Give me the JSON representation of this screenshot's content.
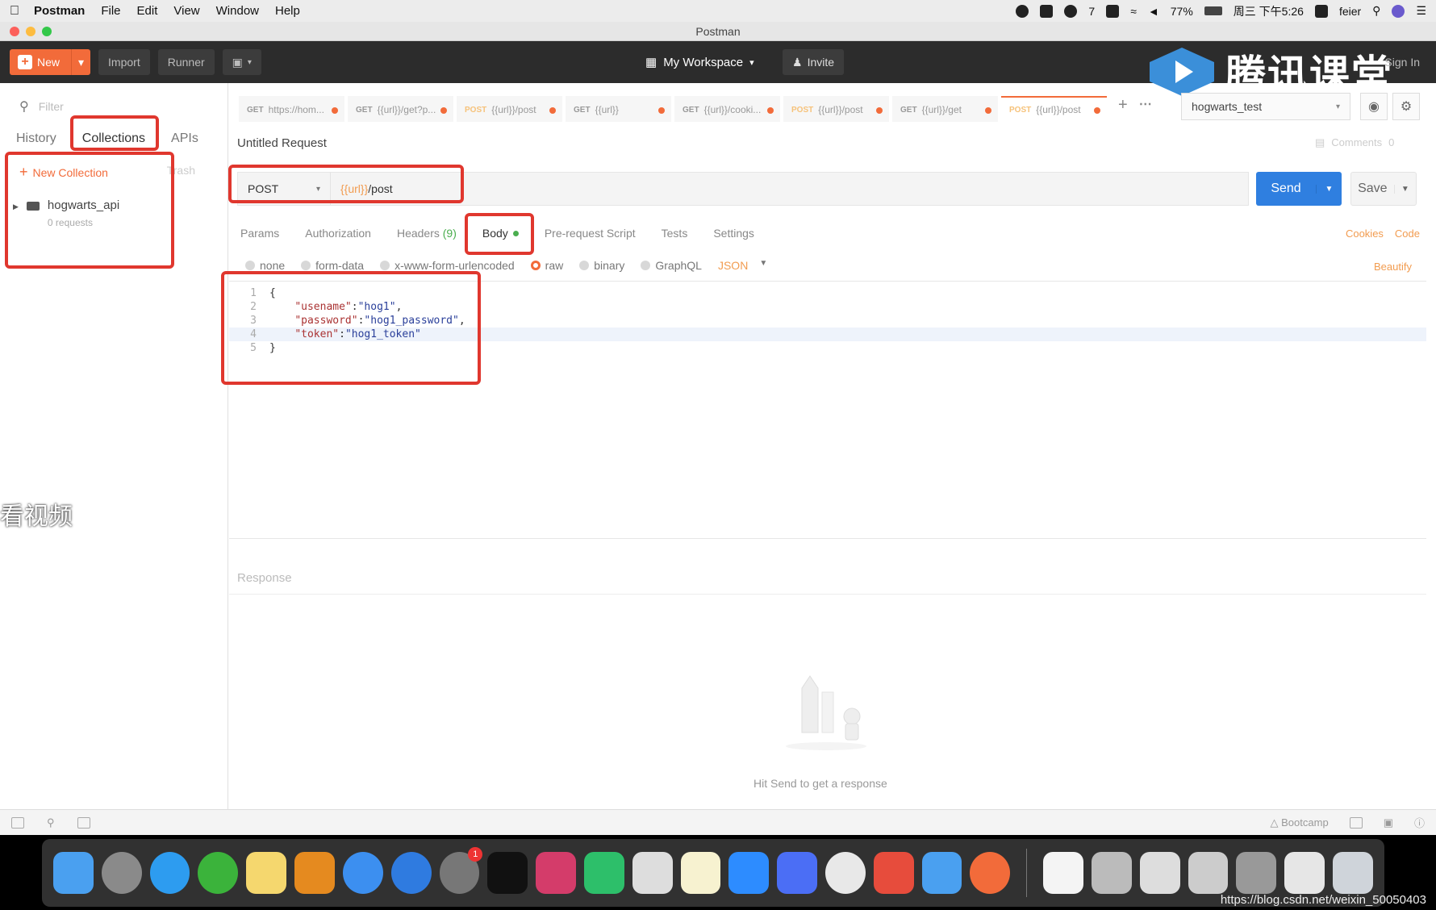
{
  "menubar": {
    "app_name": "Postman",
    "menus": [
      "File",
      "Edit",
      "View",
      "Window",
      "Help"
    ],
    "wechat_count": "7",
    "battery": "77%",
    "clock": "周三 下午5:26",
    "user": "feier"
  },
  "window": {
    "title": "Postman"
  },
  "toolbar": {
    "new_label": "New",
    "import_label": "Import",
    "runner_label": "Runner",
    "workspace_label": "My Workspace",
    "invite_label": "Invite",
    "signin_label": "Sign In",
    "watermark_text": "腾讯课堂"
  },
  "sidebar": {
    "filter_placeholder": "Filter",
    "tabs": [
      "History",
      "Collections",
      "APIs"
    ],
    "new_collection_label": "New Collection",
    "trash_label": "Trash",
    "collections": [
      {
        "name": "hogwarts_api",
        "meta": "0 requests"
      }
    ]
  },
  "request_tabs": [
    {
      "method": "GET",
      "url": "https://hom..."
    },
    {
      "method": "GET",
      "url": "{{url}}/get?p..."
    },
    {
      "method": "POST",
      "url": "{{url}}/post"
    },
    {
      "method": "GET",
      "url": "{{url}}"
    },
    {
      "method": "GET",
      "url": "{{url}}/cooki..."
    },
    {
      "method": "POST",
      "url": "{{url}}/post"
    },
    {
      "method": "GET",
      "url": "{{url}}/get"
    },
    {
      "method": "POST",
      "url": "{{url}}/post"
    }
  ],
  "environment": {
    "selected": "hogwarts_test"
  },
  "request": {
    "title": "Untitled Request",
    "comments_label": "Comments",
    "comments_count": "0",
    "method": "POST",
    "url_var": "{{url}}",
    "url_path": "/post",
    "send_label": "Send",
    "save_label": "Save"
  },
  "request_subtabs": {
    "params": "Params",
    "authorization": "Authorization",
    "headers": "Headers",
    "headers_count": "(9)",
    "body": "Body",
    "prerequest": "Pre-request Script",
    "tests": "Tests",
    "settings": "Settings",
    "cookies": "Cookies",
    "code": "Code"
  },
  "body_types": {
    "options": [
      "none",
      "form-data",
      "x-www-form-urlencoded",
      "raw",
      "binary",
      "GraphQL"
    ],
    "selected": "raw",
    "format": "JSON",
    "beautify_label": "Beautify"
  },
  "editor": {
    "lines": [
      {
        "n": "1",
        "code": "{"
      },
      {
        "n": "2",
        "key": "\"usename\"",
        "val": "\"hog1\"",
        "tail": ","
      },
      {
        "n": "3",
        "key": "\"password\"",
        "val": "\"hog1_password\"",
        "tail": ","
      },
      {
        "n": "4",
        "key": "\"token\"",
        "val": "\"hog1_token\"",
        "tail": ""
      },
      {
        "n": "5",
        "code": "}"
      }
    ]
  },
  "response": {
    "label": "Response",
    "hint": "Hit Send to get a response"
  },
  "side_watermark": "看视频",
  "statusbar": {
    "bootcamp_label": "Bootcamp"
  },
  "footer_url": "https://blog.csdn.net/weixin_50050403",
  "dock_badge": "1",
  "colors": {
    "accent": "#f26b3a",
    "send_blue": "#2f7fe0",
    "highlight_red": "#e0372e",
    "toolbar_dark": "#2c2c2c"
  }
}
